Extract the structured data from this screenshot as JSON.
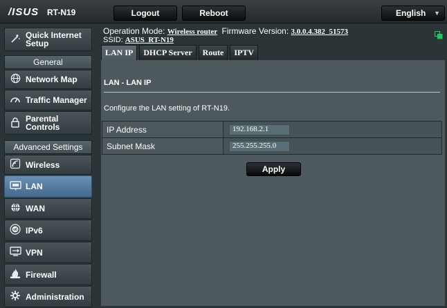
{
  "header": {
    "logo": "/ISUS",
    "model": "RT-N19",
    "logout_label": "Logout",
    "reboot_label": "Reboot",
    "language": "English"
  },
  "sidebar": {
    "quick_setup": {
      "label": "Quick Internet Setup",
      "icon": "wizard-icon"
    },
    "general_header": "General",
    "general_items": [
      {
        "label": "Network Map",
        "icon": "globe-icon"
      },
      {
        "label": "Traffic Manager",
        "icon": "gauge-icon"
      },
      {
        "label": "Parental Controls",
        "icon": "lock-icon"
      }
    ],
    "advanced_header": "Advanced Settings",
    "advanced_items": [
      {
        "label": "Wireless",
        "icon": "wireless-icon"
      },
      {
        "label": "LAN",
        "icon": "lan-icon",
        "active": true
      },
      {
        "label": "WAN",
        "icon": "wan-globe-icon"
      },
      {
        "label": "IPv6",
        "icon": "ipv6-icon"
      },
      {
        "label": "VPN",
        "icon": "vpn-icon"
      },
      {
        "label": "Firewall",
        "icon": "fire-icon"
      },
      {
        "label": "Administration",
        "icon": "admin-icon"
      }
    ]
  },
  "status": {
    "op_mode_label": "Operation Mode:",
    "op_mode_value": "Wireless router",
    "firmware_label": "Firmware Version:",
    "firmware_value": "3.0.0.4.382_51573",
    "ssid_label": "SSID:",
    "ssid_value": "ASUS_RT-N19"
  },
  "tabs": [
    {
      "label": "LAN IP",
      "active": true
    },
    {
      "label": "DHCP Server"
    },
    {
      "label": "Route"
    },
    {
      "label": "IPTV"
    }
  ],
  "panel": {
    "title": "LAN - LAN IP",
    "description": "Configure the LAN setting of RT-N19.",
    "fields": [
      {
        "label": "IP Address",
        "value": "192.168.2.1"
      },
      {
        "label": "Subnet Mask",
        "value": "255.255.255.0"
      }
    ],
    "apply_label": "Apply"
  },
  "colors": {
    "background": "#4d595d",
    "active_menu": "#5a80a6",
    "divider": "#a7d2e2",
    "network_icon": "#22c55e"
  }
}
